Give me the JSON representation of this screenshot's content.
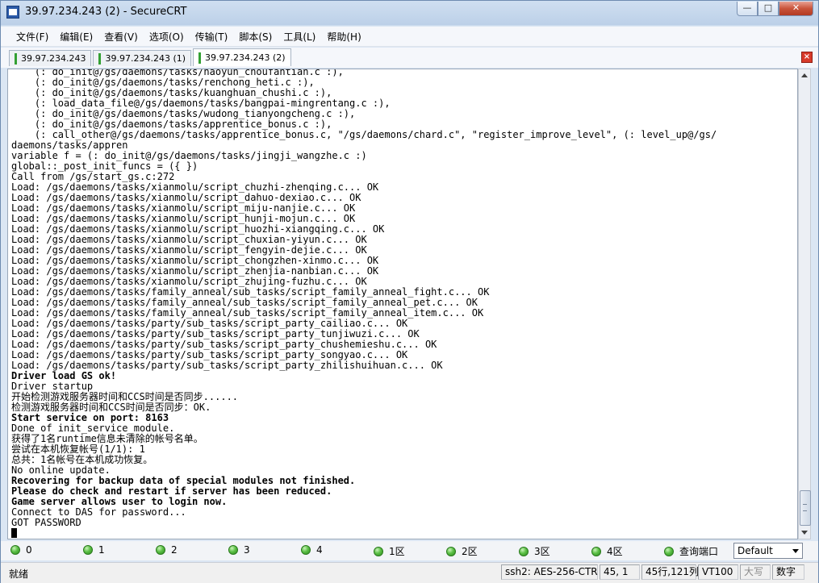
{
  "window": {
    "title": "39.97.234.243 (2) - SecureCRT"
  },
  "window_buttons": {
    "minimize": "—",
    "maximize": "□",
    "close": "✕"
  },
  "menu": [
    {
      "label": "文件(F)"
    },
    {
      "label": "编辑(E)"
    },
    {
      "label": "查看(V)"
    },
    {
      "label": "选项(O)"
    },
    {
      "label": "传输(T)"
    },
    {
      "label": "脚本(S)"
    },
    {
      "label": "工具(L)"
    },
    {
      "label": "帮助(H)"
    }
  ],
  "tabs": [
    {
      "label": "39.97.234.243"
    },
    {
      "label": "39.97.234.243 (1)"
    },
    {
      "label": "39.97.234.243 (2)"
    }
  ],
  "tab_close": "×",
  "terminal": {
    "lines": [
      "    (: do_init@/gs/daemons/tasks/haoyun_choufantian.c :),",
      "    (: do_init@/gs/daemons/tasks/renchong_heti.c :),",
      "    (: do_init@/gs/daemons/tasks/kuanghuan_chushi.c :),",
      "    (: load_data_file@/gs/daemons/tasks/bangpai-mingrentang.c :),",
      "    (: do_init@/gs/daemons/tasks/wudong_tianyongcheng.c :),",
      "    (: do_init@/gs/daemons/tasks/apprentice_bonus.c :),",
      "    (: call_other@/gs/daemons/tasks/apprentice_bonus.c, \"/gs/daemons/chard.c\", \"register_improve_level\", (: level_up@/gs/",
      "daemons/tasks/appren",
      "variable f = (: do_init@/gs/daemons/tasks/jingji_wangzhe.c :)",
      "global::_post_init_funcs = ({ })",
      "Call from /gs/start_gs.c:272",
      "Load: /gs/daemons/tasks/xianmolu/script_chuzhi-zhenqing.c... OK",
      "Load: /gs/daemons/tasks/xianmolu/script_dahuo-dexiao.c... OK",
      "Load: /gs/daemons/tasks/xianmolu/script_miju-nanjie.c... OK",
      "Load: /gs/daemons/tasks/xianmolu/script_hunji-mojun.c... OK",
      "Load: /gs/daemons/tasks/xianmolu/script_huozhi-xiangqing.c... OK",
      "Load: /gs/daemons/tasks/xianmolu/script_chuxian-yiyun.c... OK",
      "Load: /gs/daemons/tasks/xianmolu/script_fengyin-dejie.c... OK",
      "Load: /gs/daemons/tasks/xianmolu/script_chongzhen-xinmo.c... OK",
      "Load: /gs/daemons/tasks/xianmolu/script_zhenjia-nanbian.c... OK",
      "Load: /gs/daemons/tasks/xianmolu/script_zhujing-fuzhu.c... OK",
      "Load: /gs/daemons/tasks/family_anneal/sub_tasks/script_family_anneal_fight.c... OK",
      "Load: /gs/daemons/tasks/family_anneal/sub_tasks/script_family_anneal_pet.c... OK",
      "Load: /gs/daemons/tasks/family_anneal/sub_tasks/script_family_anneal_item.c... OK",
      "Load: /gs/daemons/tasks/party/sub_tasks/script_party_cailiao.c... OK",
      "Load: /gs/daemons/tasks/party/sub_tasks/script_party_tunjiwuzi.c... OK",
      "Load: /gs/daemons/tasks/party/sub_tasks/script_party_chushemieshu.c... OK",
      "Load: /gs/daemons/tasks/party/sub_tasks/script_party_songyao.c... OK",
      "Load: /gs/daemons/tasks/party/sub_tasks/script_party_zhilishuihuan.c... OK",
      "Driver load GS ok!",
      "Driver startup",
      "开始检测游戏服务器时间和CCS时间是否同步......",
      "检测游戏服务器时间和CCS时间是否同步：OK.",
      "Start service on port: 8163",
      "Done of init_service_module.",
      "获得了1名runtime信息未清除的帐号名单。",
      "尝试在本机恢复帐号(1/1): 1",
      "总共：1名帐号在本机成功恢复。",
      "No online update.",
      "Recovering for backup data of special modules not finished.",
      "Please do check and restart if server has been reduced.",
      "Game server allows user to login now.",
      "Connect to DAS for password...",
      "GOT PASSWORD"
    ],
    "bold_lines": [
      29,
      33,
      39,
      40,
      41
    ]
  },
  "sessions": [
    {
      "label": "0"
    },
    {
      "label": "1"
    },
    {
      "label": "2"
    },
    {
      "label": "3"
    },
    {
      "label": "4"
    },
    {
      "label": "1区"
    },
    {
      "label": "2区"
    },
    {
      "label": "3区"
    },
    {
      "label": "4区"
    },
    {
      "label": "查询端口"
    }
  ],
  "session_select": {
    "value": "Default"
  },
  "status": {
    "ready": "就绪",
    "cipher": "ssh2: AES-256-CTR",
    "cursor": "45,   1",
    "size": "45行,121列",
    "emulation": "VT100",
    "caps": "大写",
    "num": "数字"
  },
  "colors": {
    "session_led": "#5cc046",
    "tab_marker": "#33a033",
    "close": "#d83b2a"
  }
}
